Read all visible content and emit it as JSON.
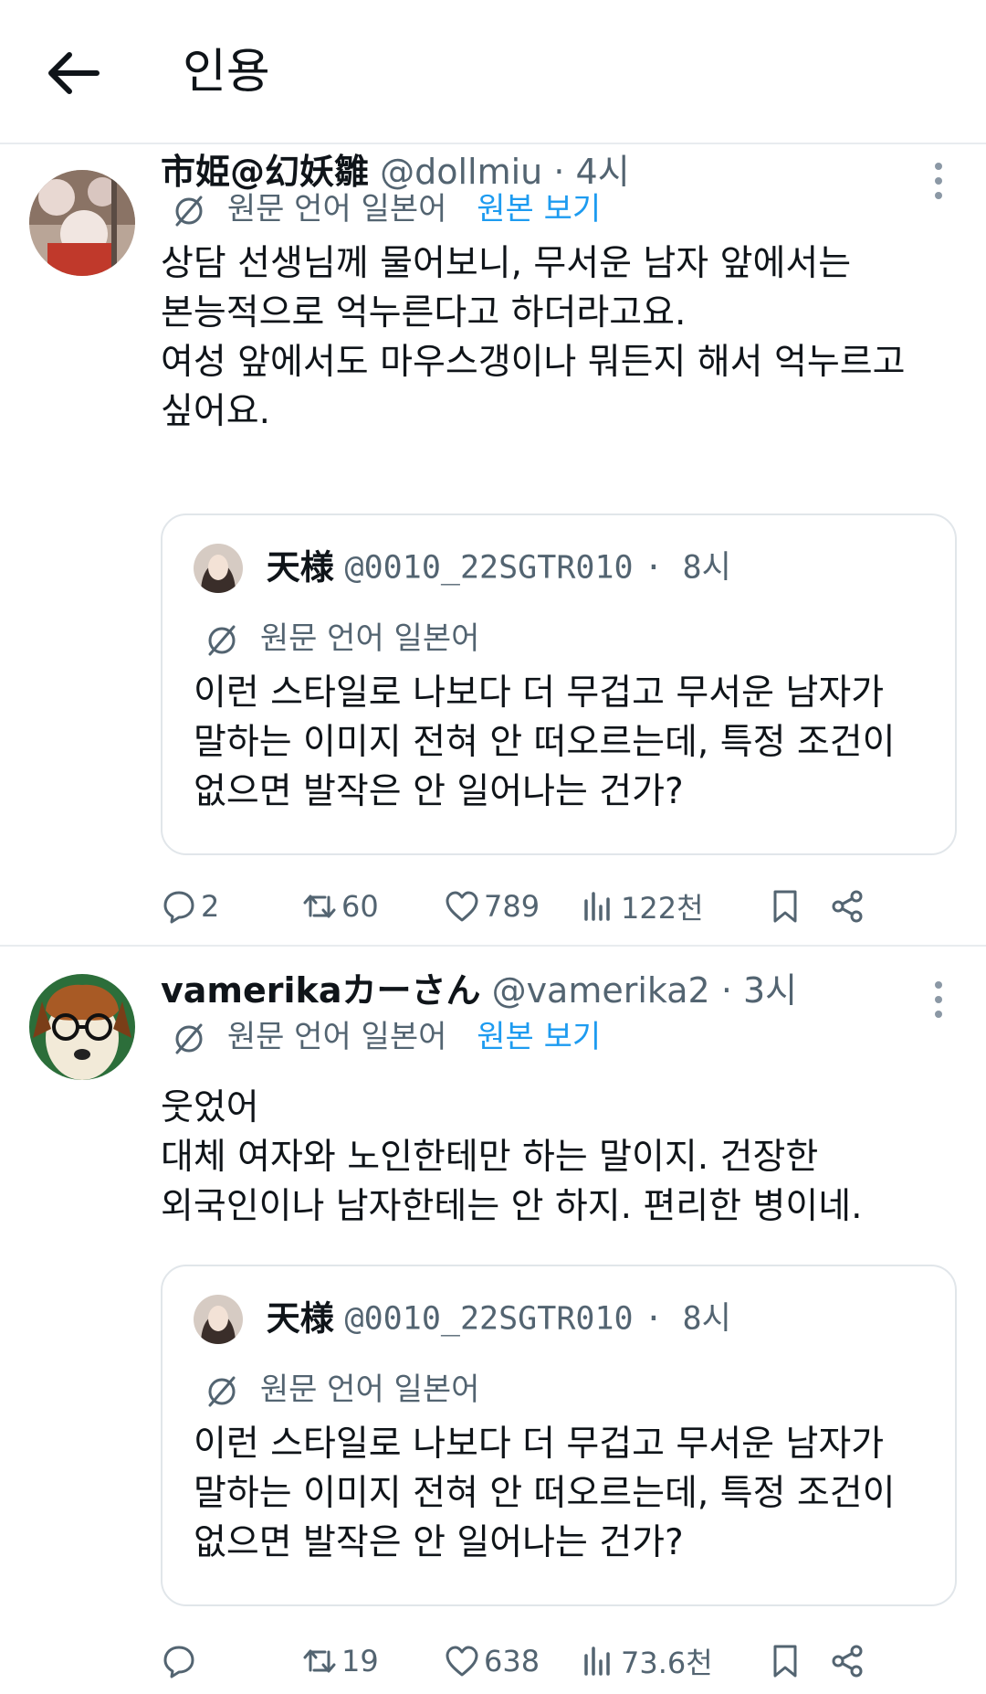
{
  "header": {
    "title": "인용"
  },
  "posts": [
    {
      "display_name": "市姫@幻妖雛",
      "handle": "@dollmiu",
      "time": "· 4시",
      "lang_label": "원문 언어 일본어",
      "view_original": "원본 보기",
      "body_lines": [
        "상담 선생님께 물어보니, 무서운 남자 앞에서는",
        "본능적으로 억누른다고 하더라고요.",
        "여성 앞에서도 마우스갱이나 뭐든지 해서 억누르고",
        "싶어요."
      ],
      "quote": {
        "display_name": "天様",
        "handle": "@0010_22SGTR010",
        "time": "· 8시",
        "lang_label": "원문 언어 일본어",
        "body_lines": [
          "이런 스타일로 나보다 더 무겁고 무서운 남자가",
          "말하는 이미지 전혀 안 떠오르는데, 특정 조건이",
          "없으면 발작은 안 일어나는 건가?"
        ]
      },
      "actions": {
        "replies": "2",
        "reposts": "60",
        "likes": "789",
        "views": "122천"
      }
    },
    {
      "display_name": "vamerikaカーさん",
      "handle": "@vamerika2",
      "time": "· 3시",
      "lang_label": "원문 언어 일본어",
      "view_original": "원본 보기",
      "body_lines": [
        "웃었어",
        "대체 여자와 노인한테만 하는 말이지. 건장한",
        "외국인이나 남자한테는 안 하지. 편리한 병이네."
      ],
      "quote": {
        "display_name": "天様",
        "handle": "@0010_22SGTR010",
        "time": "· 8시",
        "lang_label": "원문 언어 일본어",
        "body_lines": [
          "이런 스타일로 나보다 더 무겁고 무서운 남자가",
          "말하는 이미지 전혀 안 떠오르는데, 특정 조건이",
          "없으면 발작은 안 일어나는 건가?"
        ]
      },
      "actions": {
        "replies": "",
        "reposts": "19",
        "likes": "638",
        "views": "73.6천"
      }
    }
  ],
  "colors": {
    "text": "#0f1419",
    "muted": "#536471",
    "link": "#1d9bf0",
    "border": "#e1e6ea"
  },
  "icons": [
    "back-arrow-icon",
    "more-vertical-icon",
    "translate-icon",
    "reply-icon",
    "repost-icon",
    "like-icon",
    "views-icon",
    "bookmark-icon",
    "share-icon"
  ]
}
